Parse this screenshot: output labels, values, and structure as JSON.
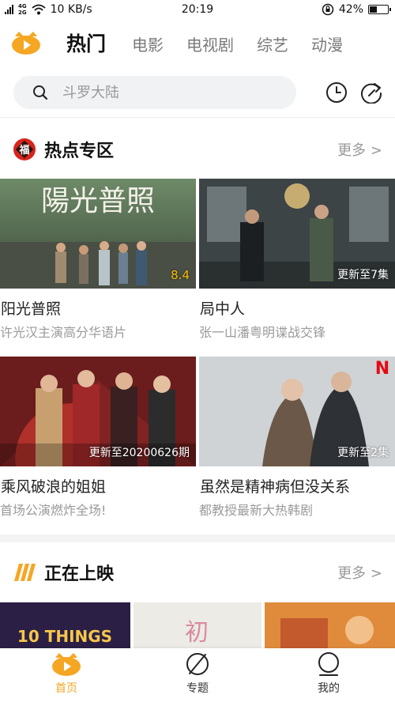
{
  "status_bar": {
    "network_top": "4G",
    "network_bottom": "2G",
    "speed": "10 KB/s",
    "time": "20:19",
    "battery": "42%",
    "battery_level": 0.42
  },
  "topnav": {
    "tabs": [
      "热门",
      "电影",
      "电视剧",
      "综艺",
      "动漫"
    ],
    "active_index": 0
  },
  "search": {
    "placeholder": "斗罗大陆"
  },
  "section_hot": {
    "title": "热点专区",
    "badge_text": "福",
    "more_label": "更多 >"
  },
  "cards": [
    {
      "title": "阳光普照",
      "subtitle": "许光汉主演高分华语片",
      "overlay": "8.4",
      "poster_text": "陽光普照"
    },
    {
      "title": "局中人",
      "subtitle": "张一山潘粤明谍战交锋",
      "overlay": "更新至7集"
    },
    {
      "title": "乘风破浪的姐姐",
      "subtitle": "首场公演燃炸全场!",
      "overlay": "更新至20200626期"
    },
    {
      "title": "虽然是精神病但没关系",
      "subtitle": "都教授最新大热韩剧",
      "overlay": "更新至2集",
      "poster_mark": "N"
    }
  ],
  "section_showing": {
    "title": "正在上映",
    "more_label": "更多 >"
  },
  "posters": [
    {
      "text": "10 THINGS"
    },
    {
      "text": "初"
    },
    {
      "text": ""
    }
  ],
  "bottom_nav": {
    "items": [
      "首页",
      "专题",
      "我的"
    ],
    "active_index": 0
  },
  "colors": {
    "accent": "#f5a623",
    "badge_red": "#d7251c",
    "score": "#f5b800"
  }
}
